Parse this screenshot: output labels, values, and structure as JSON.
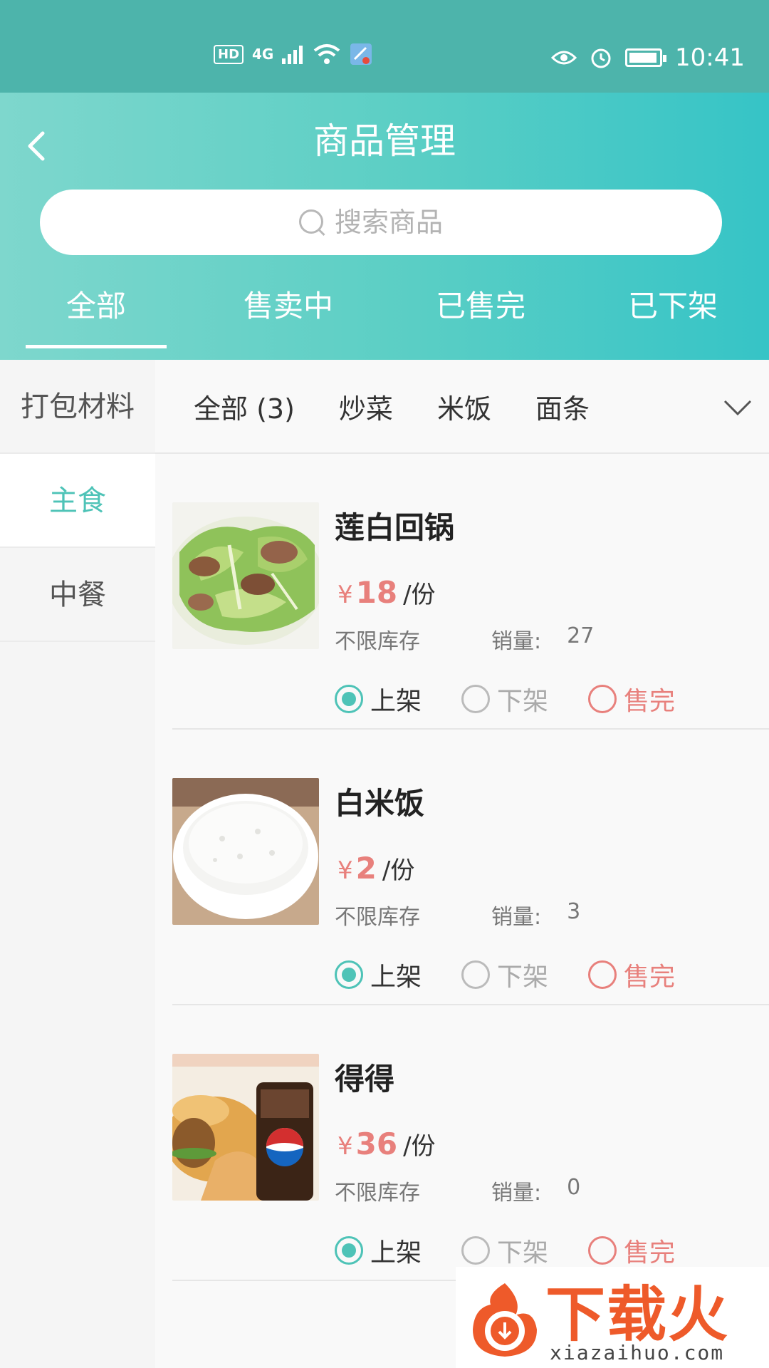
{
  "status_bar": {
    "hd": "HD",
    "network": "4G",
    "time": "10:41"
  },
  "header": {
    "title": "商品管理",
    "search_placeholder": "搜索商品",
    "tabs": [
      "全部",
      "售卖中",
      "已售完",
      "已下架"
    ]
  },
  "sidebar": {
    "items": [
      "打包材料",
      "主食",
      "中餐"
    ],
    "active_index": 1
  },
  "categories": {
    "items": [
      "全部 (3)",
      "炒菜",
      "米饭",
      "面条"
    ]
  },
  "products": [
    {
      "name": "莲白回锅",
      "currency": "¥",
      "price": "18",
      "unit": "/份",
      "stock": "不限库存",
      "sales_label": "销量:",
      "sales": "27",
      "options": [
        "上架",
        "下架",
        "售完"
      ],
      "selected": "上架"
    },
    {
      "name": "白米饭",
      "currency": "¥",
      "price": "2",
      "unit": "/份",
      "stock": "不限库存",
      "sales_label": "销量:",
      "sales": "3",
      "options": [
        "上架",
        "下架",
        "售完"
      ],
      "selected": "上架"
    },
    {
      "name": "得得",
      "currency": "¥",
      "price": "36",
      "unit": "/份",
      "stock": "不限库存",
      "sales_label": "销量:",
      "sales": "0",
      "options": [
        "上架",
        "下架",
        "售完"
      ],
      "selected": "上架"
    }
  ],
  "watermark": {
    "brand": "下载火",
    "domain": "xiazaihuo.com"
  },
  "colors": {
    "accent": "#4ec3b7",
    "price": "#e8807c",
    "status_bar": "#4db4ab"
  }
}
